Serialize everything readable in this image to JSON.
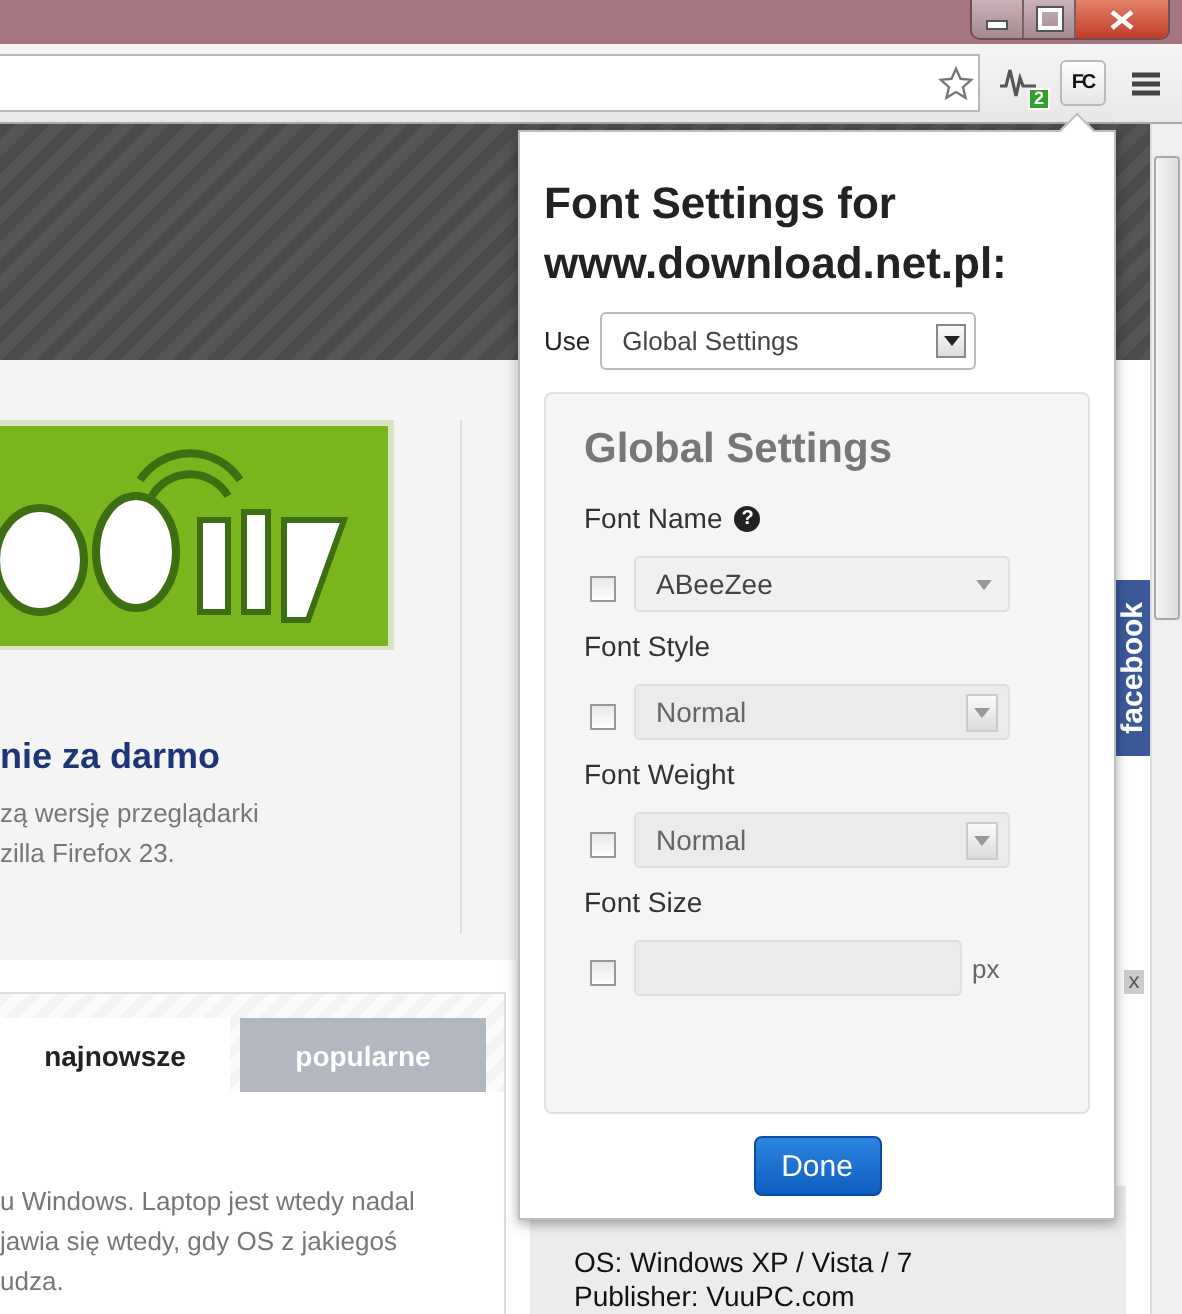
{
  "toolbar": {
    "extension_badge": "2",
    "extension_letters": "FC"
  },
  "page": {
    "headline": "nie za darmo",
    "description": [
      "zą wersję przeglądarki",
      "zilla Firefox 23."
    ],
    "tabs": [
      {
        "label": "najnowsze",
        "selected": true
      },
      {
        "label": "popularne",
        "selected": false
      }
    ],
    "article_lines": [
      "u Windows. Laptop jest wtedy nadal",
      "jawia się wtedy, gdy OS z jakiegoś",
      "udza."
    ],
    "facebook_tab": "facebook",
    "close_mark": "x",
    "sidebar_lines": [
      "OS: Windows XP / Vista / 7",
      "Publisher: VuuPC.com"
    ]
  },
  "popup": {
    "title": "Font Settings for www.download.net.pl:",
    "use_label": "Use",
    "use_value": "Global Settings",
    "panel_title": "Global Settings",
    "fields": [
      {
        "kind": "combo",
        "label": "Font Name",
        "help": "?",
        "value": "ABeeZee",
        "checked": false
      },
      {
        "kind": "select",
        "label": "Font Style",
        "value": "Normal",
        "checked": false
      },
      {
        "kind": "select",
        "label": "Font Weight",
        "value": "Normal",
        "checked": false
      },
      {
        "kind": "number",
        "label": "Font Size",
        "unit": "px",
        "checked": false
      }
    ],
    "done": "Done"
  }
}
